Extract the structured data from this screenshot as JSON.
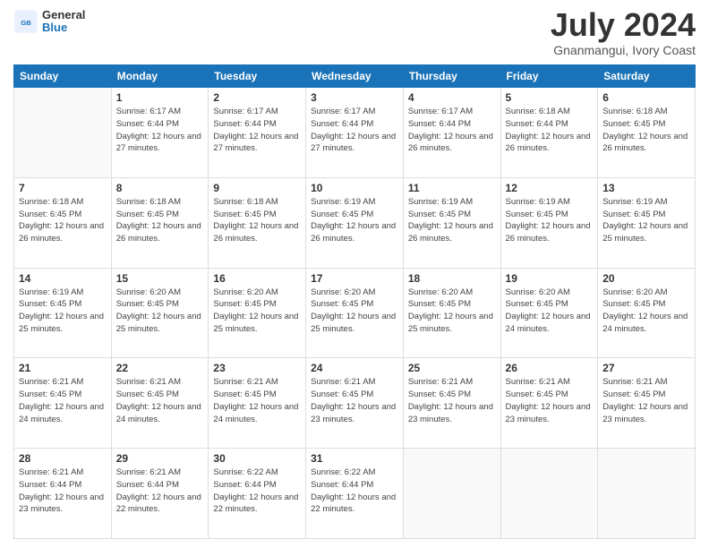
{
  "header": {
    "logo": {
      "general": "General",
      "blue": "Blue"
    },
    "month": "July 2024",
    "location": "Gnanmangui, Ivory Coast"
  },
  "calendar": {
    "days_of_week": [
      "Sunday",
      "Monday",
      "Tuesday",
      "Wednesday",
      "Thursday",
      "Friday",
      "Saturday"
    ],
    "weeks": [
      [
        {
          "day": "",
          "sunrise": "",
          "sunset": "",
          "daylight": ""
        },
        {
          "day": "1",
          "sunrise": "6:17 AM",
          "sunset": "6:44 PM",
          "daylight": "12 hours and 27 minutes."
        },
        {
          "day": "2",
          "sunrise": "6:17 AM",
          "sunset": "6:44 PM",
          "daylight": "12 hours and 27 minutes."
        },
        {
          "day": "3",
          "sunrise": "6:17 AM",
          "sunset": "6:44 PM",
          "daylight": "12 hours and 27 minutes."
        },
        {
          "day": "4",
          "sunrise": "6:17 AM",
          "sunset": "6:44 PM",
          "daylight": "12 hours and 26 minutes."
        },
        {
          "day": "5",
          "sunrise": "6:18 AM",
          "sunset": "6:44 PM",
          "daylight": "12 hours and 26 minutes."
        },
        {
          "day": "6",
          "sunrise": "6:18 AM",
          "sunset": "6:45 PM",
          "daylight": "12 hours and 26 minutes."
        }
      ],
      [
        {
          "day": "7",
          "sunrise": "6:18 AM",
          "sunset": "6:45 PM",
          "daylight": "12 hours and 26 minutes."
        },
        {
          "day": "8",
          "sunrise": "6:18 AM",
          "sunset": "6:45 PM",
          "daylight": "12 hours and 26 minutes."
        },
        {
          "day": "9",
          "sunrise": "6:18 AM",
          "sunset": "6:45 PM",
          "daylight": "12 hours and 26 minutes."
        },
        {
          "day": "10",
          "sunrise": "6:19 AM",
          "sunset": "6:45 PM",
          "daylight": "12 hours and 26 minutes."
        },
        {
          "day": "11",
          "sunrise": "6:19 AM",
          "sunset": "6:45 PM",
          "daylight": "12 hours and 26 minutes."
        },
        {
          "day": "12",
          "sunrise": "6:19 AM",
          "sunset": "6:45 PM",
          "daylight": "12 hours and 26 minutes."
        },
        {
          "day": "13",
          "sunrise": "6:19 AM",
          "sunset": "6:45 PM",
          "daylight": "12 hours and 25 minutes."
        }
      ],
      [
        {
          "day": "14",
          "sunrise": "6:19 AM",
          "sunset": "6:45 PM",
          "daylight": "12 hours and 25 minutes."
        },
        {
          "day": "15",
          "sunrise": "6:20 AM",
          "sunset": "6:45 PM",
          "daylight": "12 hours and 25 minutes."
        },
        {
          "day": "16",
          "sunrise": "6:20 AM",
          "sunset": "6:45 PM",
          "daylight": "12 hours and 25 minutes."
        },
        {
          "day": "17",
          "sunrise": "6:20 AM",
          "sunset": "6:45 PM",
          "daylight": "12 hours and 25 minutes."
        },
        {
          "day": "18",
          "sunrise": "6:20 AM",
          "sunset": "6:45 PM",
          "daylight": "12 hours and 25 minutes."
        },
        {
          "day": "19",
          "sunrise": "6:20 AM",
          "sunset": "6:45 PM",
          "daylight": "12 hours and 24 minutes."
        },
        {
          "day": "20",
          "sunrise": "6:20 AM",
          "sunset": "6:45 PM",
          "daylight": "12 hours and 24 minutes."
        }
      ],
      [
        {
          "day": "21",
          "sunrise": "6:21 AM",
          "sunset": "6:45 PM",
          "daylight": "12 hours and 24 minutes."
        },
        {
          "day": "22",
          "sunrise": "6:21 AM",
          "sunset": "6:45 PM",
          "daylight": "12 hours and 24 minutes."
        },
        {
          "day": "23",
          "sunrise": "6:21 AM",
          "sunset": "6:45 PM",
          "daylight": "12 hours and 24 minutes."
        },
        {
          "day": "24",
          "sunrise": "6:21 AM",
          "sunset": "6:45 PM",
          "daylight": "12 hours and 23 minutes."
        },
        {
          "day": "25",
          "sunrise": "6:21 AM",
          "sunset": "6:45 PM",
          "daylight": "12 hours and 23 minutes."
        },
        {
          "day": "26",
          "sunrise": "6:21 AM",
          "sunset": "6:45 PM",
          "daylight": "12 hours and 23 minutes."
        },
        {
          "day": "27",
          "sunrise": "6:21 AM",
          "sunset": "6:45 PM",
          "daylight": "12 hours and 23 minutes."
        }
      ],
      [
        {
          "day": "28",
          "sunrise": "6:21 AM",
          "sunset": "6:44 PM",
          "daylight": "12 hours and 23 minutes."
        },
        {
          "day": "29",
          "sunrise": "6:21 AM",
          "sunset": "6:44 PM",
          "daylight": "12 hours and 22 minutes."
        },
        {
          "day": "30",
          "sunrise": "6:22 AM",
          "sunset": "6:44 PM",
          "daylight": "12 hours and 22 minutes."
        },
        {
          "day": "31",
          "sunrise": "6:22 AM",
          "sunset": "6:44 PM",
          "daylight": "12 hours and 22 minutes."
        },
        {
          "day": "",
          "sunrise": "",
          "sunset": "",
          "daylight": ""
        },
        {
          "day": "",
          "sunrise": "",
          "sunset": "",
          "daylight": ""
        },
        {
          "day": "",
          "sunrise": "",
          "sunset": "",
          "daylight": ""
        }
      ]
    ]
  }
}
